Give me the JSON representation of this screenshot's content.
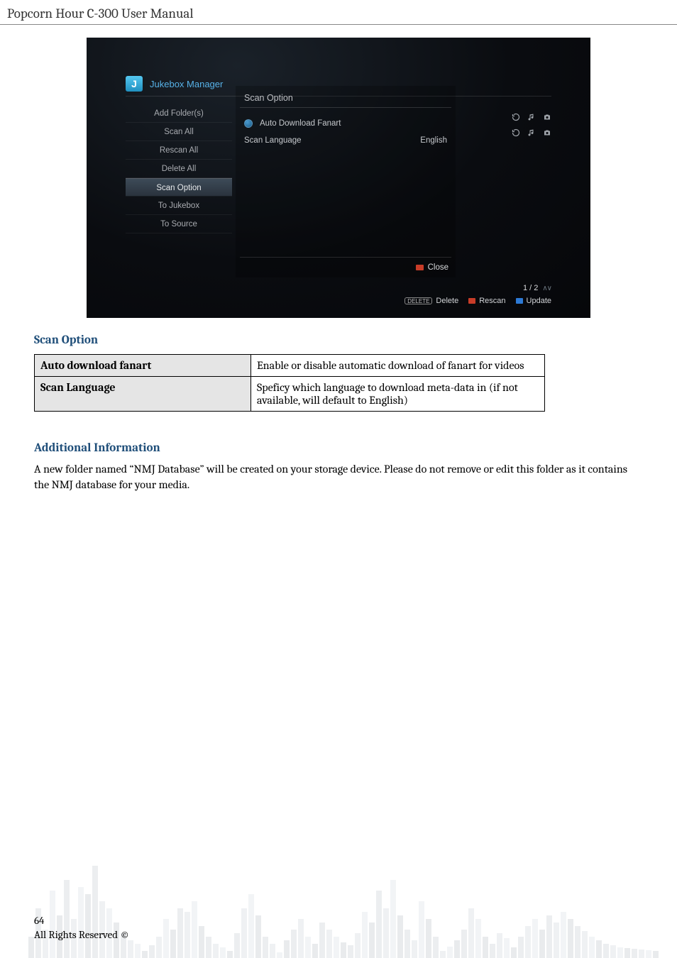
{
  "doc_header": "Popcorn Hour C-300 User Manual",
  "screenshot": {
    "app_title": "Jukebox Manager",
    "app_icon_letter": "J",
    "sidebar": {
      "items": [
        {
          "label": "Add Folder(s)",
          "selected": false
        },
        {
          "label": "Scan All",
          "selected": false
        },
        {
          "label": "Rescan All",
          "selected": false
        },
        {
          "label": "Delete All",
          "selected": false
        },
        {
          "label": "Scan Option",
          "selected": true
        },
        {
          "label": "To Jukebox",
          "selected": false
        },
        {
          "label": "To Source",
          "selected": false
        }
      ]
    },
    "panel": {
      "title": "Scan Option",
      "row1_label": "Auto Download Fanart",
      "row2_label": "Scan Language",
      "row2_value": "English",
      "close_label": "Close"
    },
    "pager": "1 / 2",
    "legend": {
      "delete_key": "DELETE",
      "delete_label": "Delete",
      "rescan_label": "Rescan",
      "update_label": "Update"
    }
  },
  "section1_title": "Scan Option",
  "table": {
    "r1_label": "Auto download fanart",
    "r1_desc": "Enable or disable automatic download of fanart for videos",
    "r2_label": "Scan Language",
    "r2_desc": "Speficy which language to download meta-data in (if not available, will default to English)"
  },
  "section2_title": "Additional Information",
  "section2_body": "A new folder named “NMJ Database” will be created on your storage device. Please do not remove or edit this folder as it contains the NMJ database for your media.",
  "footer": {
    "page_number": "64",
    "rights": "All Rights Reserved ©"
  }
}
